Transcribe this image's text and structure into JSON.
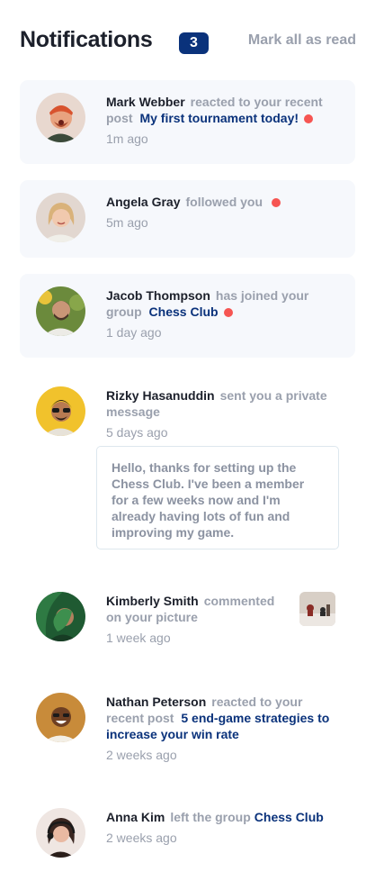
{
  "header": {
    "title": "Notifications",
    "count": "3",
    "mark_all": "Mark all as read"
  },
  "notifications": [
    {
      "name": "Mark Webber",
      "action": "reacted to your recent post",
      "link": "My first tournament today!",
      "time": "1m ago",
      "unread": true
    },
    {
      "name": "Angela Gray",
      "action": "followed you",
      "link": "",
      "time": "5m ago",
      "unread": true
    },
    {
      "name": "Jacob Thompson",
      "action": "has joined your group",
      "link": "Chess Club",
      "time": "1 day ago",
      "unread": true
    },
    {
      "name": "Rizky Hasanuddin",
      "action": "sent you a private message",
      "link": "",
      "time": "5 days ago",
      "unread": false,
      "message": "Hello, thanks for setting up the Chess Club. I've been a member for a few weeks now and I'm already having lots of fun and improving my game."
    },
    {
      "name": "Kimberly Smith",
      "action": "commented on your picture",
      "link": "",
      "time": "1 week ago",
      "unread": false
    },
    {
      "name": "Nathan Peterson",
      "action": "reacted to your recent post",
      "link": "5 end-game strategies to increase your win rate",
      "time": "2 weeks ago",
      "unread": false
    },
    {
      "name": "Anna Kim",
      "action": "left the group",
      "link": "Chess Club",
      "time": "2 weeks ago",
      "unread": false
    }
  ],
  "colors": {
    "unread_bg": "#f6f8fc",
    "dot": "#f65552",
    "link": "#0a327b",
    "badge": "#0a327b"
  }
}
